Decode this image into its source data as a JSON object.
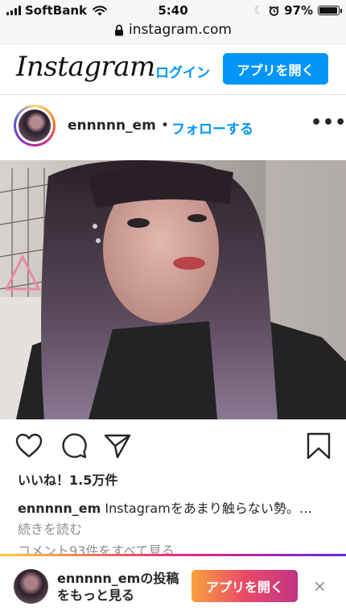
{
  "status_bar": {
    "carrier": "SoftBank",
    "time": "5:40",
    "battery": "97%",
    "battery_level": 0.97,
    "icons": [
      "signal-icon",
      "wifi-icon",
      "moon-icon",
      "alarm-icon",
      "battery-icon"
    ]
  },
  "browser": {
    "url": "instagram.com",
    "lock_icon": "lock-icon"
  },
  "header": {
    "logo": "Instagram",
    "login": "ログイン",
    "open_app": "アプリを開く",
    "accent": "#0095f6"
  },
  "post": {
    "username": "ennnnn_em",
    "separator": "•",
    "follow": "フォローする",
    "more_icon": "more-dots-icon",
    "actions": [
      "heart-icon",
      "comment-icon",
      "share-icon",
      "bookmark-icon"
    ],
    "likes": "いいね！1.5万件",
    "caption_user": "ennnnn_em",
    "caption_text": "Instagramをあまり触らない勢。…",
    "read_more": "続きを読む",
    "view_comments": "コメント93件をすべて見る"
  },
  "banner": {
    "text": "ennnnn_emの投稿をもっと見る",
    "button": "アプリを開く",
    "close": "×"
  }
}
